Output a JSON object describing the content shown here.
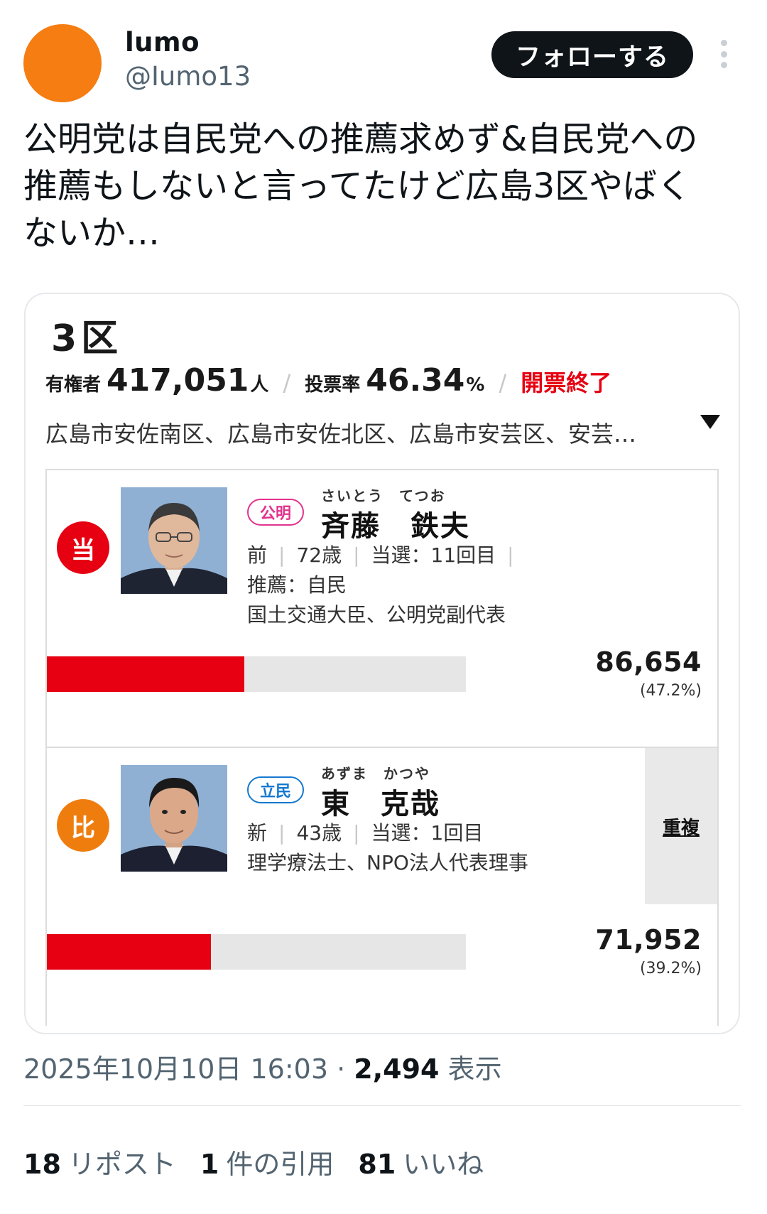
{
  "user": {
    "display_name": "lumo",
    "handle": "@Iumo13"
  },
  "follow_label": "フォローする",
  "tweet_text": "公明党は自民党への推薦求めず&自民党への\n推薦もしないと言ってたけど広島3区やばく\nないか…",
  "card": {
    "district": "3区",
    "electorate_label": "有権者",
    "electorate_value": "417,051",
    "electorate_unit": "人",
    "turnout_label": "投票率",
    "turnout_value": "46.34",
    "turnout_unit": "%",
    "status": "開票終了",
    "areas": "広島市安佐南区、広島市安佐北区、広島市安芸区、安芸…",
    "candidates": [
      {
        "mark": "当",
        "party": "公明",
        "furigana": "さいとう　てつお",
        "name": "斉藤　鉄夫",
        "status": "前",
        "age": "72歳",
        "terms": "当選：11回目",
        "info2": "推薦：自民",
        "info3": "国土交通大臣、公明党副代表",
        "votes": "86,654",
        "pct_label": "(47.2%)",
        "share": 0.472
      },
      {
        "mark": "比",
        "party": "立民",
        "furigana": "あずま　かつや",
        "name": "東　克哉",
        "status": "新",
        "age": "43歳",
        "terms": "当選：1回目",
        "info2": "理学療法士、NPO法人代表理事",
        "duplicate": "重複",
        "votes": "71,952",
        "pct_label": "(39.2%)",
        "share": 0.392
      }
    ]
  },
  "timestamp": "2025年10月10日 16:03",
  "views_count": "2,494",
  "views_label": "表示",
  "metrics": {
    "reposts_count": "18",
    "reposts_label": "リポスト",
    "quotes_count": "1",
    "quotes_label": "件の引用",
    "likes_count": "81",
    "likes_label": "いいね"
  },
  "colors": {
    "winner_mark": "#e60012",
    "pr_mark": "#ef7d0e",
    "vote_bar": "#e60012",
    "komei": "#e3338e",
    "rikken": "#1679d0"
  }
}
